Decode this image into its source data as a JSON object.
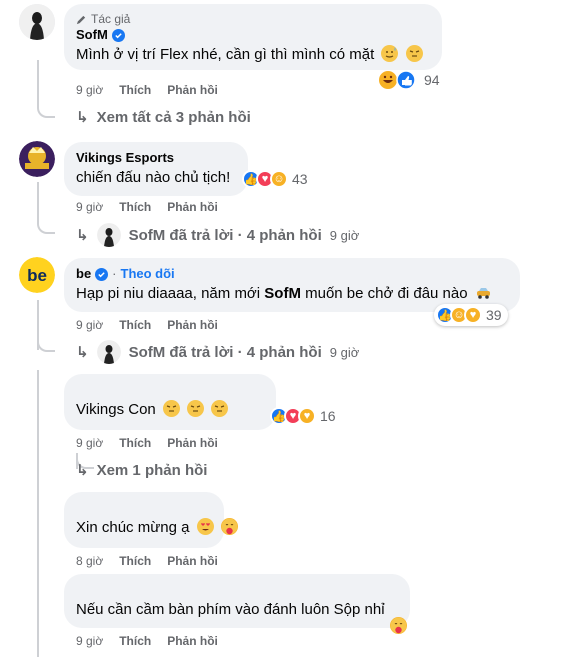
{
  "comments": [
    {
      "author_tag": "Tác giả",
      "name": "SofM",
      "text": "Mình ở vị trí Flex nhé, cần gì thì mình có mặt",
      "time": "9 giờ",
      "like_label": "Thích",
      "reply_label": "Phản hồi",
      "reaction_count": "94",
      "view_replies": "Xem tất cả 3 phản hồi"
    },
    {
      "name": "Vikings Esports",
      "text": "chiến đấu nào chủ tịch!",
      "time": "9 giờ",
      "like_label": "Thích",
      "reply_label": "Phản hồi",
      "reaction_count": "43",
      "reply_summary": "SofM đã trả lời · 4 phản hồi",
      "reply_time": "9 giờ"
    },
    {
      "name": "be",
      "follow": "Theo dõi",
      "text_pre": "Hạp pi niu diaaaa, năm mới ",
      "text_bold": "SofM",
      "text_post": " muốn be chở đi đâu nào",
      "time": "9 giờ",
      "like_label": "Thích",
      "reply_label": "Phản hồi",
      "reaction_count": "39",
      "reply_summary": "SofM đã trả lời · 4 phản hồi",
      "reply_time": "9 giờ"
    },
    {
      "text": "Vikings Con",
      "time": "9 giờ",
      "like_label": "Thích",
      "reply_label": "Phản hồi",
      "reaction_count": "16",
      "view_replies": "Xem 1 phản hồi"
    },
    {
      "text": "Xin chúc mừng ạ",
      "time": "8 giờ",
      "like_label": "Thích",
      "reply_label": "Phản hồi"
    },
    {
      "text": "Nếu cần cầm bàn phím vào đánh luôn Sộp nhỉ",
      "time": "9 giờ",
      "like_label": "Thích",
      "reply_label": "Phản hồi"
    }
  ],
  "colors": {
    "bubble_bg": "#f0f2f5",
    "like_blue": "#1877f2",
    "love_red": "#f33e58",
    "haha_yellow": "#f7b125",
    "meta_gray": "#65676b"
  }
}
